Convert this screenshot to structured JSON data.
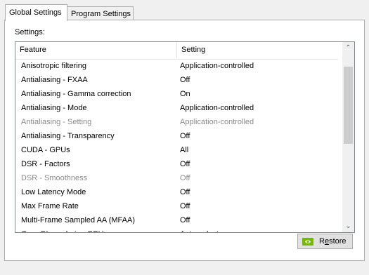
{
  "tabs": [
    {
      "label": "Global Settings",
      "active": true
    },
    {
      "label": "Program Settings",
      "active": false
    }
  ],
  "settings_label": "Settings:",
  "table": {
    "columns": [
      "Feature",
      "Setting"
    ],
    "rows": [
      {
        "feature": "Anisotropic filtering",
        "setting": "Application-controlled",
        "enabled": true
      },
      {
        "feature": "Antialiasing - FXAA",
        "setting": "Off",
        "enabled": true
      },
      {
        "feature": "Antialiasing - Gamma correction",
        "setting": "On",
        "enabled": true
      },
      {
        "feature": "Antialiasing - Mode",
        "setting": "Application-controlled",
        "enabled": true
      },
      {
        "feature": "Antialiasing - Setting",
        "setting": "Application-controlled",
        "enabled": false
      },
      {
        "feature": "Antialiasing - Transparency",
        "setting": "Off",
        "enabled": true
      },
      {
        "feature": "CUDA - GPUs",
        "setting": "All",
        "enabled": true
      },
      {
        "feature": "DSR - Factors",
        "setting": "Off",
        "enabled": true
      },
      {
        "feature": "DSR - Smoothness",
        "setting": "Off",
        "enabled": false
      },
      {
        "feature": "Low Latency Mode",
        "setting": "Off",
        "enabled": true
      },
      {
        "feature": "Max Frame Rate",
        "setting": "Off",
        "enabled": true
      },
      {
        "feature": "Multi-Frame Sampled AA (MFAA)",
        "setting": "Off",
        "enabled": true
      },
      {
        "feature": "OpenGL rendering GPU",
        "setting": "Auto-select",
        "enabled": true
      }
    ]
  },
  "restore_button": {
    "label_prefix": "R",
    "label_accel": "e",
    "label_suffix": "store",
    "icon": "nvidia-logo-icon"
  },
  "colors": {
    "accent": "#76b900",
    "disabled_text": "#8a8a8a"
  }
}
